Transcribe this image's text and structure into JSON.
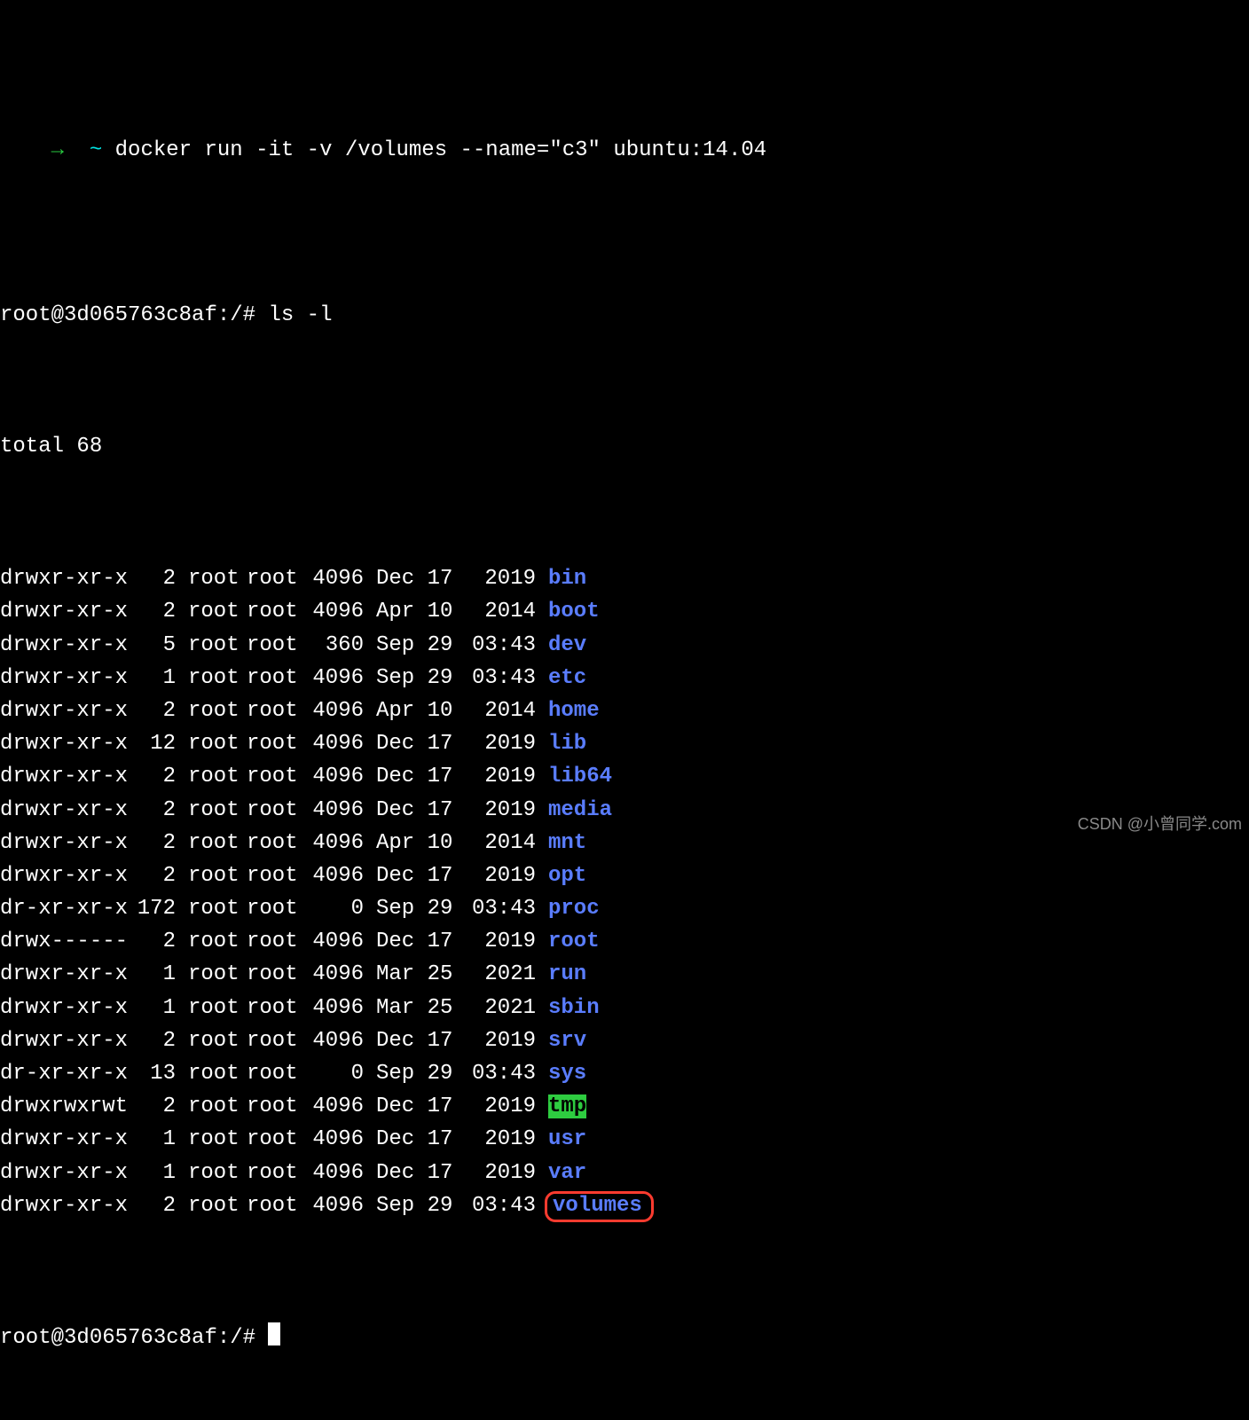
{
  "prompt1": {
    "arrow": "→",
    "tilde": "~",
    "command": "docker run -it -v /volumes --name=\"c3\" ubuntu:14.04"
  },
  "prompt2": {
    "ps1": "root@3d065763c8af:/#",
    "command": "ls -l"
  },
  "total": "total 68",
  "rows": [
    {
      "perms": "drwxr-xr-x",
      "links": "2",
      "owner": "root",
      "group": "root",
      "size": "4096",
      "date": "Dec 17",
      "time": "2019",
      "name": "bin",
      "style": "dir",
      "hl": false
    },
    {
      "perms": "drwxr-xr-x",
      "links": "2",
      "owner": "root",
      "group": "root",
      "size": "4096",
      "date": "Apr 10",
      "time": "2014",
      "name": "boot",
      "style": "dir",
      "hl": false
    },
    {
      "perms": "drwxr-xr-x",
      "links": "5",
      "owner": "root",
      "group": "root",
      "size": "360",
      "date": "Sep 29",
      "time": "03:43",
      "name": "dev",
      "style": "dir",
      "hl": false
    },
    {
      "perms": "drwxr-xr-x",
      "links": "1",
      "owner": "root",
      "group": "root",
      "size": "4096",
      "date": "Sep 29",
      "time": "03:43",
      "name": "etc",
      "style": "dir",
      "hl": false
    },
    {
      "perms": "drwxr-xr-x",
      "links": "2",
      "owner": "root",
      "group": "root",
      "size": "4096",
      "date": "Apr 10",
      "time": "2014",
      "name": "home",
      "style": "dir",
      "hl": false
    },
    {
      "perms": "drwxr-xr-x",
      "links": "12",
      "owner": "root",
      "group": "root",
      "size": "4096",
      "date": "Dec 17",
      "time": "2019",
      "name": "lib",
      "style": "dir",
      "hl": false
    },
    {
      "perms": "drwxr-xr-x",
      "links": "2",
      "owner": "root",
      "group": "root",
      "size": "4096",
      "date": "Dec 17",
      "time": "2019",
      "name": "lib64",
      "style": "dir",
      "hl": false
    },
    {
      "perms": "drwxr-xr-x",
      "links": "2",
      "owner": "root",
      "group": "root",
      "size": "4096",
      "date": "Dec 17",
      "time": "2019",
      "name": "media",
      "style": "dir",
      "hl": false
    },
    {
      "perms": "drwxr-xr-x",
      "links": "2",
      "owner": "root",
      "group": "root",
      "size": "4096",
      "date": "Apr 10",
      "time": "2014",
      "name": "mnt",
      "style": "dir",
      "hl": false
    },
    {
      "perms": "drwxr-xr-x",
      "links": "2",
      "owner": "root",
      "group": "root",
      "size": "4096",
      "date": "Dec 17",
      "time": "2019",
      "name": "opt",
      "style": "dir",
      "hl": false
    },
    {
      "perms": "dr-xr-xr-x",
      "links": "172",
      "owner": "root",
      "group": "root",
      "size": "0",
      "date": "Sep 29",
      "time": "03:43",
      "name": "proc",
      "style": "dir",
      "hl": false
    },
    {
      "perms": "drwx------",
      "links": "2",
      "owner": "root",
      "group": "root",
      "size": "4096",
      "date": "Dec 17",
      "time": "2019",
      "name": "root",
      "style": "dir",
      "hl": false
    },
    {
      "perms": "drwxr-xr-x",
      "links": "1",
      "owner": "root",
      "group": "root",
      "size": "4096",
      "date": "Mar 25",
      "time": "2021",
      "name": "run",
      "style": "dir",
      "hl": false
    },
    {
      "perms": "drwxr-xr-x",
      "links": "1",
      "owner": "root",
      "group": "root",
      "size": "4096",
      "date": "Mar 25",
      "time": "2021",
      "name": "sbin",
      "style": "dir",
      "hl": false
    },
    {
      "perms": "drwxr-xr-x",
      "links": "2",
      "owner": "root",
      "group": "root",
      "size": "4096",
      "date": "Dec 17",
      "time": "2019",
      "name": "srv",
      "style": "dir",
      "hl": false
    },
    {
      "perms": "dr-xr-xr-x",
      "links": "13",
      "owner": "root",
      "group": "root",
      "size": "0",
      "date": "Sep 29",
      "time": "03:43",
      "name": "sys",
      "style": "dir",
      "hl": false
    },
    {
      "perms": "drwxrwxrwt",
      "links": "2",
      "owner": "root",
      "group": "root",
      "size": "4096",
      "date": "Dec 17",
      "time": "2019",
      "name": "tmp",
      "style": "stk",
      "hl": false
    },
    {
      "perms": "drwxr-xr-x",
      "links": "1",
      "owner": "root",
      "group": "root",
      "size": "4096",
      "date": "Dec 17",
      "time": "2019",
      "name": "usr",
      "style": "dir",
      "hl": false
    },
    {
      "perms": "drwxr-xr-x",
      "links": "1",
      "owner": "root",
      "group": "root",
      "size": "4096",
      "date": "Dec 17",
      "time": "2019",
      "name": "var",
      "style": "dir",
      "hl": false
    },
    {
      "perms": "drwxr-xr-x",
      "links": "2",
      "owner": "root",
      "group": "root",
      "size": "4096",
      "date": "Sep 29",
      "time": "03:43",
      "name": "volumes",
      "style": "dir",
      "hl": true
    }
  ],
  "prompt3": {
    "ps1": "root@3d065763c8af:/#"
  },
  "watermark": "CSDN @小曾同学.com"
}
